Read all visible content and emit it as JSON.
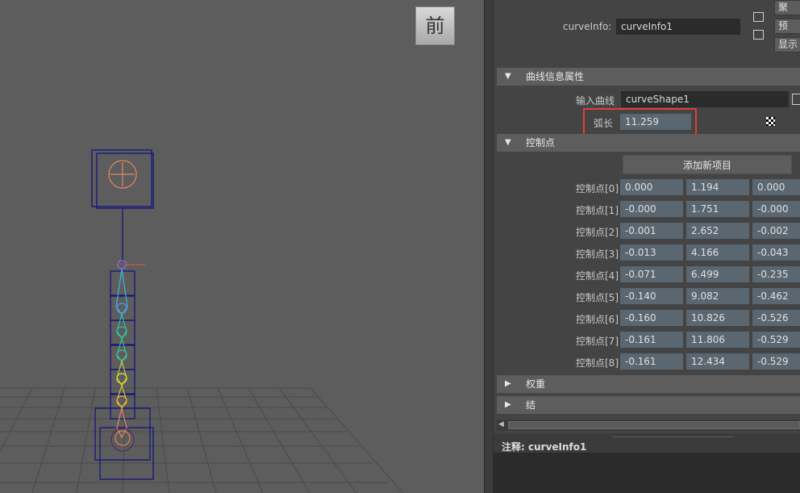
{
  "viewport": {
    "view_cube_label": "前"
  },
  "attribute_editor": {
    "node_label": "curveInfo:",
    "node_name": "curveInfo1",
    "side_buttons": [
      "聚",
      "预",
      "显示"
    ],
    "sections": {
      "curve_info": {
        "title": "曲线信息属性",
        "input_curve_label": "输入曲线",
        "input_curve_value": "curveShape1",
        "arc_length_label": "弧长",
        "arc_length_value": "11.259"
      },
      "control_points": {
        "title": "控制点",
        "add_button": "添加新项目",
        "rows": [
          {
            "label": "控制点[0]",
            "x": "0.000",
            "y": "1.194",
            "z": "0.000"
          },
          {
            "label": "控制点[1]",
            "x": "-0.000",
            "y": "1.751",
            "z": "-0.000"
          },
          {
            "label": "控制点[2]",
            "x": "-0.001",
            "y": "2.652",
            "z": "-0.002"
          },
          {
            "label": "控制点[3]",
            "x": "-0.013",
            "y": "4.166",
            "z": "-0.043"
          },
          {
            "label": "控制点[4]",
            "x": "-0.071",
            "y": "6.499",
            "z": "-0.235"
          },
          {
            "label": "控制点[5]",
            "x": "-0.140",
            "y": "9.082",
            "z": "-0.462"
          },
          {
            "label": "控制点[6]",
            "x": "-0.160",
            "y": "10.826",
            "z": "-0.526"
          },
          {
            "label": "控制点[7]",
            "x": "-0.161",
            "y": "11.806",
            "z": "-0.529"
          },
          {
            "label": "控制点[8]",
            "x": "-0.161",
            "y": "12.434",
            "z": "-0.529"
          }
        ]
      },
      "weights": {
        "title": "权重"
      },
      "knots": {
        "title": "结"
      }
    },
    "notes_label": "注释:",
    "notes_node": "curveInfo1"
  },
  "colors": {
    "highlight": "#e23c3c",
    "numeric_field": "#5a6670",
    "viewport_bg": "#5d5d5d",
    "rig_lines": "#1a1a8c"
  }
}
